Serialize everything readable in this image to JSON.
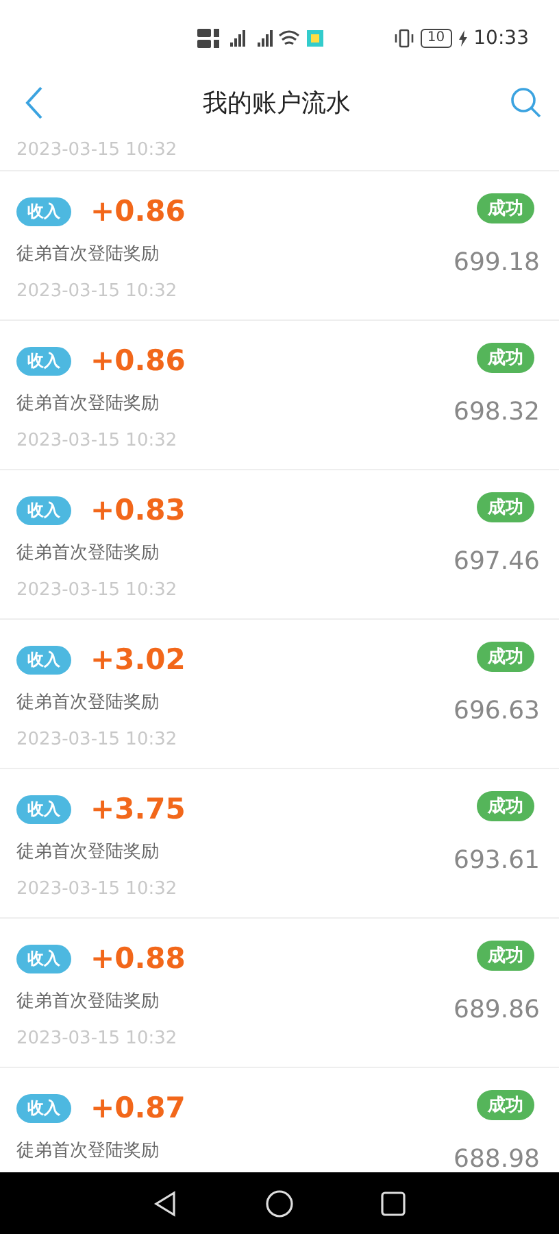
{
  "status_bar": {
    "battery": "10",
    "time": "10:33"
  },
  "header": {
    "title": "我的账户流水"
  },
  "partial_top": {
    "date": "2023-03-15 10:32"
  },
  "records": [
    {
      "tag": "收入",
      "amount": "+0.86",
      "description": "徒弟首次登陆奖励",
      "date": "2023-03-15 10:32",
      "status": "成功",
      "balance": "699.18"
    },
    {
      "tag": "收入",
      "amount": "+0.86",
      "description": "徒弟首次登陆奖励",
      "date": "2023-03-15 10:32",
      "status": "成功",
      "balance": "698.32"
    },
    {
      "tag": "收入",
      "amount": "+0.83",
      "description": "徒弟首次登陆奖励",
      "date": "2023-03-15 10:32",
      "status": "成功",
      "balance": "697.46"
    },
    {
      "tag": "收入",
      "amount": "+3.02",
      "description": "徒弟首次登陆奖励",
      "date": "2023-03-15 10:32",
      "status": "成功",
      "balance": "696.63"
    },
    {
      "tag": "收入",
      "amount": "+3.75",
      "description": "徒弟首次登陆奖励",
      "date": "2023-03-15 10:32",
      "status": "成功",
      "balance": "693.61"
    },
    {
      "tag": "收入",
      "amount": "+0.88",
      "description": "徒弟首次登陆奖励",
      "date": "2023-03-15 10:32",
      "status": "成功",
      "balance": "689.86"
    },
    {
      "tag": "收入",
      "amount": "+0.87",
      "description": "徒弟首次登陆奖励",
      "status": "成功",
      "balance": "688.98"
    }
  ]
}
